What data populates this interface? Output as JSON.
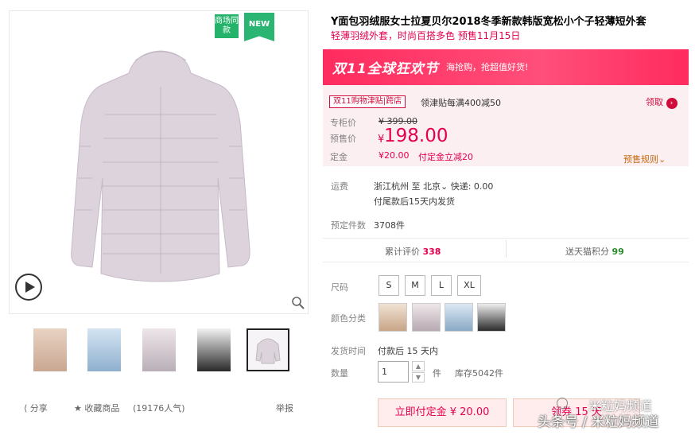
{
  "badges": {
    "mall": "商场同款",
    "new": "NEW"
  },
  "product": {
    "title": "Y面包羽绒服女士拉夏贝尔2018冬季新款韩版宽松小个子轻薄短外套",
    "subtitle": "轻薄羽绒外套，时尚百搭多色 预售11月15日"
  },
  "banner": {
    "title": "双11全球狂欢节",
    "sub": "海抢购，抢超值好货!"
  },
  "promo": {
    "tag": "双11购物津贴|跨店",
    "text": "领津贴每满400减50",
    "claim": "领取"
  },
  "price": {
    "original_label": "专柜价",
    "original": "¥ 399.00",
    "presale_label": "预售价",
    "currency": "¥",
    "presale": "198.00",
    "deposit_label": "定金",
    "deposit": "¥20.00",
    "deposit_note": "付定金立减20",
    "rules": "预售规则"
  },
  "shipping": {
    "label": "运费",
    "from": "浙江杭州",
    "to_word": "至",
    "to": "北京",
    "express": "快递: 0.00",
    "note": "付尾款后15天内发货"
  },
  "preorder": {
    "label": "预定件数",
    "value": "3708件"
  },
  "stats": {
    "reviews_label": "累计评价",
    "reviews": "338",
    "points_label": "送天猫积分",
    "points": "99"
  },
  "size": {
    "label": "尺码",
    "options": [
      "S",
      "M",
      "L",
      "XL"
    ]
  },
  "color": {
    "label": "颜色分类"
  },
  "ship_time": {
    "label": "发货时间",
    "value": "付款后 15 天内"
  },
  "quantity": {
    "label": "数量",
    "value": "1",
    "unit": "件",
    "stock": "库存5042件"
  },
  "buttons": {
    "deposit": "立即付定金 ¥ 20.00",
    "second": "领券 15 天"
  },
  "bottom": {
    "share": "分享",
    "favorite": "收藏商品",
    "popularity": "(19176人气)",
    "report": "举报"
  },
  "watermark": {
    "line1": "米粒妈频道",
    "line2": "头条号 / 米粒妈频道"
  },
  "colors": {
    "accent": "#e5004f",
    "green": "#25b36b",
    "banner": "#ff2b5e"
  }
}
